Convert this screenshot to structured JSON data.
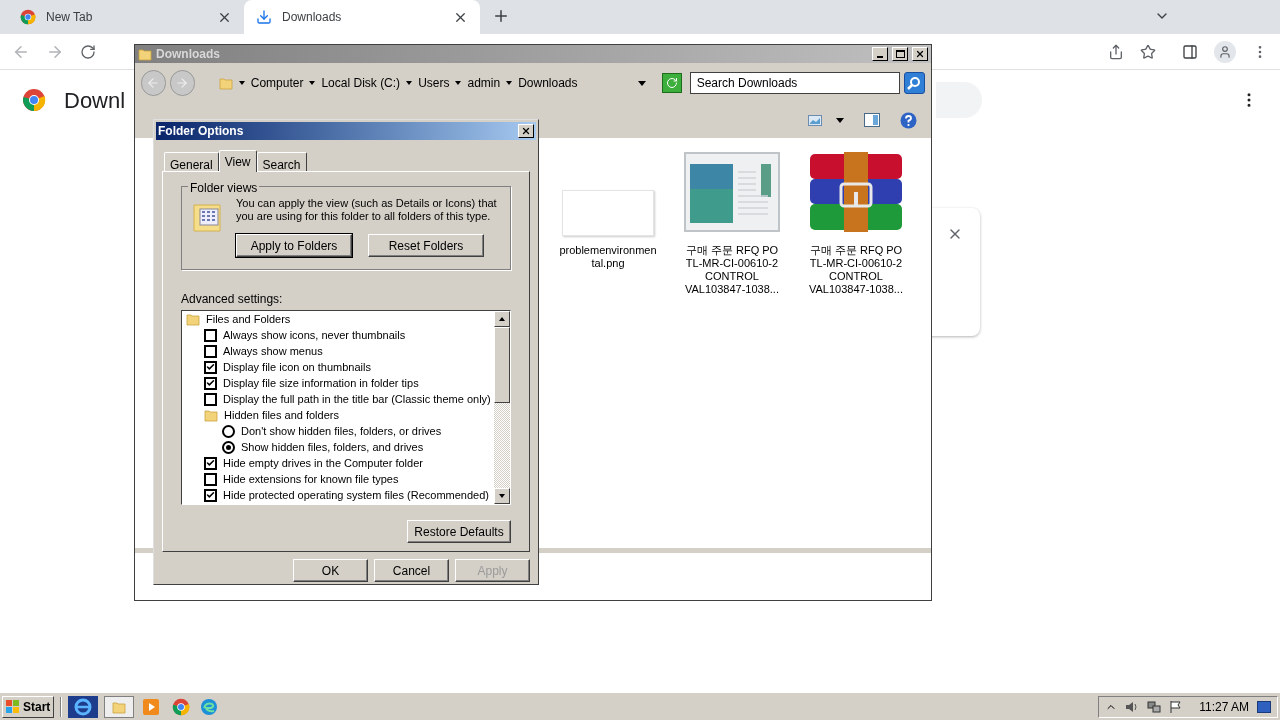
{
  "browser": {
    "tabs": [
      {
        "label": "New Tab",
        "selected": false
      },
      {
        "label": "Downloads",
        "selected": true
      }
    ],
    "page_title": "Downl"
  },
  "explorer": {
    "title": "Downloads",
    "breadcrumb": [
      "Computer",
      "Local Disk (C:)",
      "Users",
      "admin",
      "Downloads"
    ],
    "search": {
      "placeholder": "Search Downloads"
    },
    "files": [
      {
        "name": "problemenvironmental.png",
        "kind": "image"
      },
      {
        "name": "구매 주문 RFQ PO TL-MR-CI-00610-2 CONTROL VAL103847-1038...",
        "kind": "document"
      },
      {
        "name": "구매 주문 RFQ PO TL-MR-CI-00610-2 CONTROL VAL103847-1038...",
        "kind": "archive"
      }
    ]
  },
  "dialog": {
    "title": "Folder Options",
    "tabs": [
      {
        "label": "General",
        "selected": false
      },
      {
        "label": "View",
        "selected": true
      },
      {
        "label": "Search",
        "selected": false
      }
    ],
    "group_label": "Folder views",
    "description": "You can apply the view (such as Details or Icons) that you are using for this folder to all folders of this type.",
    "group_buttons": [
      "Apply to Folders",
      "Reset Folders"
    ],
    "advanced_label": "Advanced settings:",
    "settings": [
      {
        "kind": "folder",
        "label": "Files and Folders",
        "children": [
          {
            "kind": "checkbox",
            "label": "Always show icons, never thumbnails",
            "checked": false
          },
          {
            "kind": "checkbox",
            "label": "Always show menus",
            "checked": false
          },
          {
            "kind": "checkbox",
            "label": "Display file icon on thumbnails",
            "checked": true
          },
          {
            "kind": "checkbox",
            "label": "Display file size information in folder tips",
            "checked": true
          },
          {
            "kind": "checkbox",
            "label": "Display the full path in the title bar (Classic theme only)",
            "checked": false
          },
          {
            "kind": "folder",
            "label": "Hidden files and folders",
            "children": [
              {
                "kind": "radio",
                "label": "Don't show hidden files, folders, or drives",
                "selected": false
              },
              {
                "kind": "radio",
                "label": "Show hidden files, folders, and drives",
                "selected": true
              }
            ]
          },
          {
            "kind": "checkbox",
            "label": "Hide empty drives in the Computer folder",
            "checked": true
          },
          {
            "kind": "checkbox",
            "label": "Hide extensions for known file types",
            "checked": false
          },
          {
            "kind": "checkbox",
            "label": "Hide protected operating system files (Recommended)",
            "checked": true
          }
        ]
      }
    ],
    "restore_button": "Restore Defaults",
    "footer_buttons": [
      {
        "label": "OK",
        "disabled": false
      },
      {
        "label": "Cancel",
        "disabled": false
      },
      {
        "label": "Apply",
        "disabled": true
      }
    ]
  },
  "taskbar": {
    "start": "Start",
    "clock": "11:27 AM"
  }
}
